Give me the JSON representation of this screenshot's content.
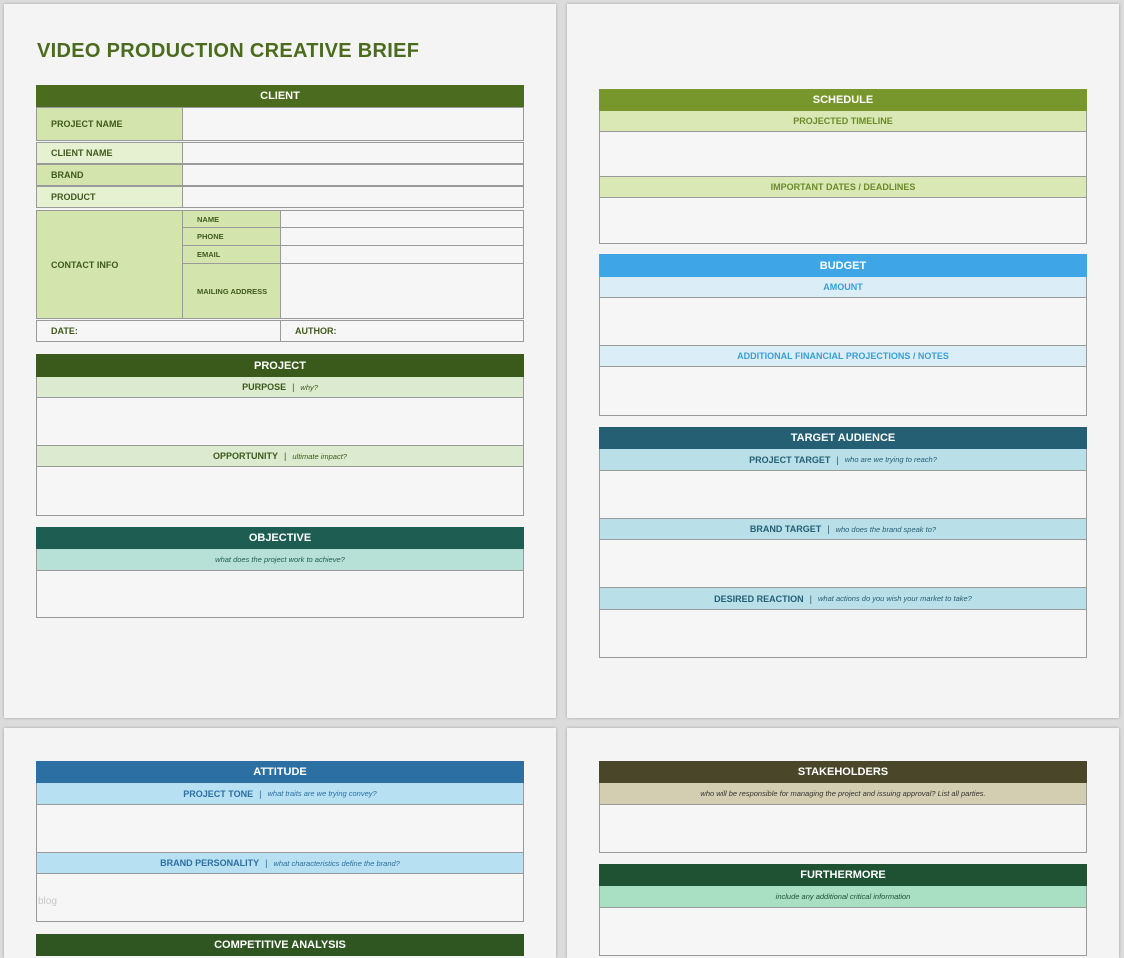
{
  "document": {
    "title": "VIDEO PRODUCTION CREATIVE BRIEF",
    "watermark": "blog"
  },
  "client": {
    "header": "CLIENT",
    "project_name": "PROJECT NAME",
    "client_name": "CLIENT NAME",
    "brand": "BRAND",
    "product": "PRODUCT",
    "contact_info": "CONTACT INFO",
    "contact_fields": {
      "name": "NAME",
      "phone": "PHONE",
      "email": "EMAIL",
      "mailing_address": "MAILING ADDRESS"
    },
    "date": "DATE:",
    "author": "AUTHOR:"
  },
  "project": {
    "header": "PROJECT",
    "purpose": "PURPOSE",
    "purpose_hint": "why?",
    "opportunity": "OPPORTUNITY",
    "opportunity_hint": "ultimate impact?"
  },
  "objective": {
    "header": "OBJECTIVE",
    "hint": "what does the project work to achieve?"
  },
  "schedule": {
    "header": "SCHEDULE",
    "timeline": "PROJECTED TIMELINE",
    "dates": "IMPORTANT DATES / DEADLINES"
  },
  "budget": {
    "header": "BUDGET",
    "amount": "AMOUNT",
    "notes": "ADDITIONAL FINANCIAL PROJECTIONS / NOTES"
  },
  "target_audience": {
    "header": "TARGET AUDIENCE",
    "project_target": "PROJECT TARGET",
    "project_target_hint": "who are we trying to reach?",
    "brand_target": "BRAND TARGET",
    "brand_target_hint": "who does the brand speak to?",
    "desired_reaction": "DESIRED REACTION",
    "desired_reaction_hint": "what actions do you wish your market to take?"
  },
  "attitude": {
    "header": "ATTITUDE",
    "project_tone": "PROJECT TONE",
    "project_tone_hint": "what traits are we trying convey?",
    "brand_personality": "BRAND PERSONALITY",
    "brand_personality_hint": "what characteristics define the brand?"
  },
  "competitive": {
    "header": "COMPETITIVE ANALYSIS"
  },
  "stakeholders": {
    "header": "STAKEHOLDERS",
    "hint": "who will be responsible for managing the project and issuing approval? List all parties."
  },
  "furthermore": {
    "header": "FURTHERMORE",
    "hint": "include any additional critical information"
  },
  "separator": "|",
  "colors": {
    "client_header": "#4b6b1e",
    "client_label_bg": "#d3e5ad",
    "project_header": "#3a5a1c",
    "project_sub_bg": "#dcebcf",
    "objective_header": "#1e5e52",
    "objective_sub_bg": "#b7e0d6",
    "schedule_header": "#77962b",
    "schedule_sub_bg": "#d9e8b4",
    "budget_header": "#3ea5e6",
    "budget_sub_bg": "#dbeef7",
    "target_header": "#245f74",
    "target_sub_bg": "#b9dfe9",
    "attitude_header": "#2c6fa3",
    "attitude_sub_bg": "#b7e0f2",
    "stakeholders_header": "#4a4629",
    "stakeholders_sub_bg": "#d3ceb2",
    "furthermore_header": "#1e5233",
    "furthermore_sub_bg": "#a9dfc2"
  }
}
